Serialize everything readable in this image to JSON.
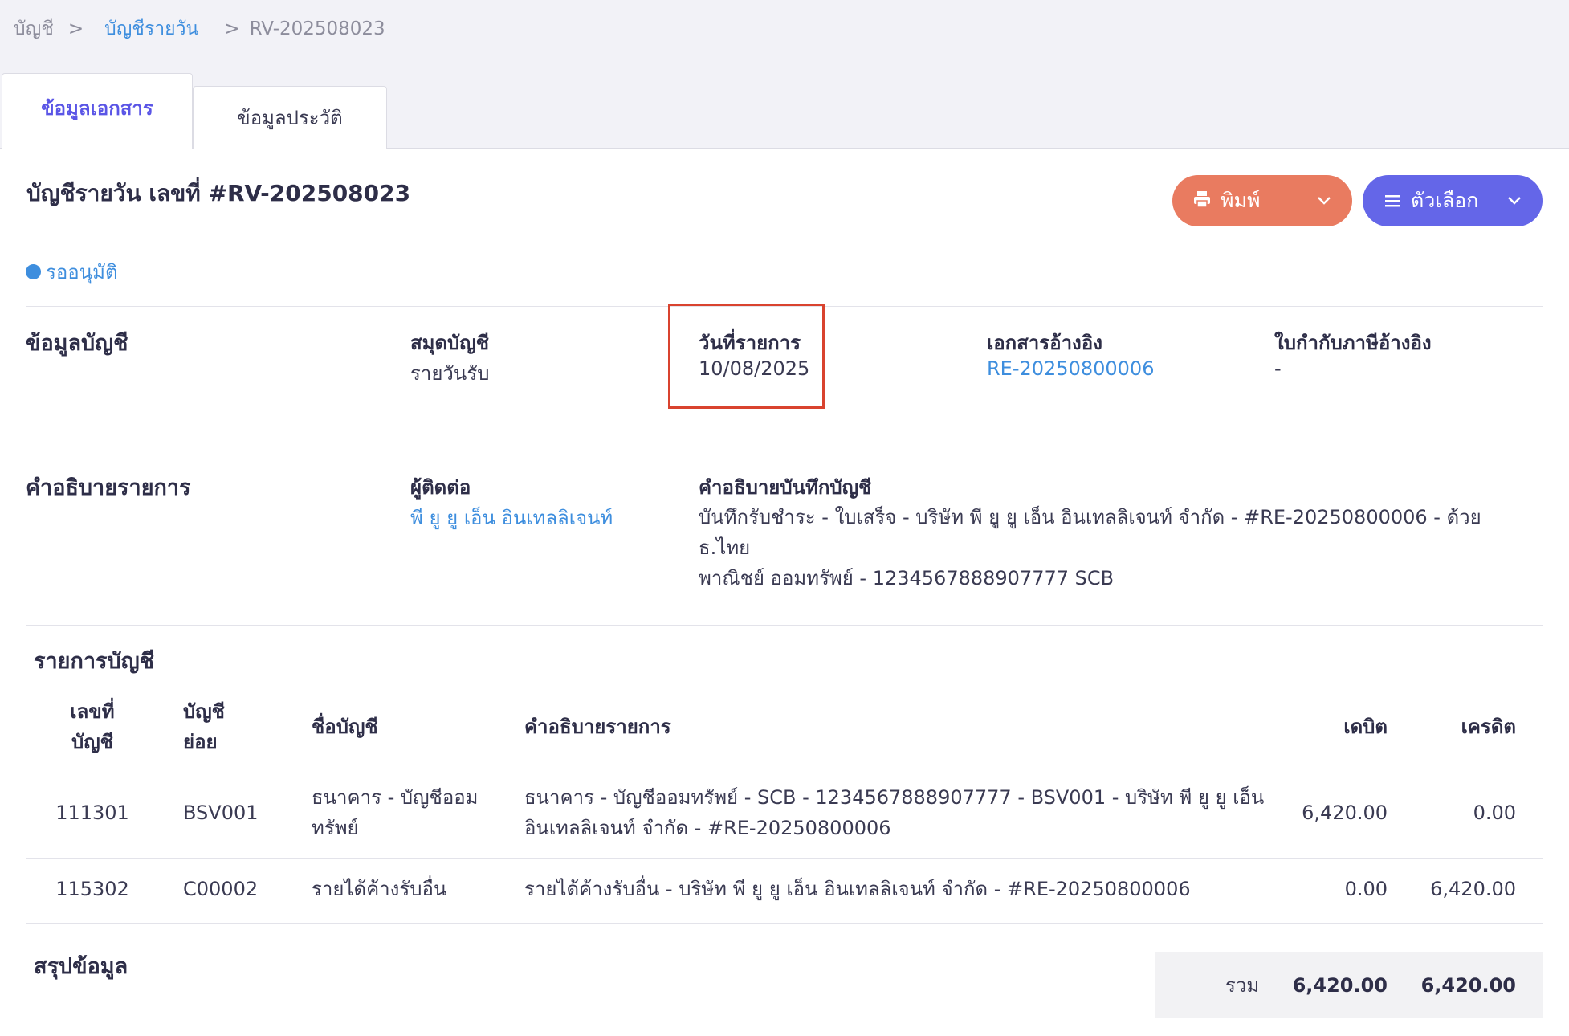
{
  "breadcrumb": {
    "root": "บัญชี",
    "parent": "บัญชีรายวัน",
    "current": "RV-202508023",
    "separator": ">"
  },
  "tabs": [
    {
      "label": "ข้อมูลเอกสาร"
    },
    {
      "label": "ข้อมูลประวัติ"
    }
  ],
  "header": {
    "title": "บัญชีรายวัน เลขที่ #RV-202508023",
    "status": "รออนุมัติ",
    "print_label": "พิมพ์",
    "options_label": "ตัวเลือก"
  },
  "account_info": {
    "section_title": "ข้อมูลบัญชี",
    "journal_label": "สมุดบัญชี",
    "journal_value": "รายวันรับ",
    "date_label": "วันที่รายการ",
    "date_value": "10/08/2025",
    "ref_doc_label": "เอกสารอ้างอิง",
    "ref_doc_value": "RE-20250800006",
    "tax_invoice_label": "ใบกำกับภาษีอ้างอิง",
    "tax_invoice_value": "-"
  },
  "description": {
    "section_title": "คำอธิบายรายการ",
    "contact_label": "ผู้ติดต่อ",
    "contact_value": "พี ยู ยู เอ็น อินเทลลิเจนท์",
    "note_label": "คำอธิบายบันทึกบัญชี",
    "note_line1": "บันทึกรับชำระ - ใบเสร็จ - บริษัท พี ยู ยู เอ็น อินเทลลิเจนท์ จำกัด - #RE-20250800006 - ด้วย ธ.ไทย",
    "note_line2": "พาณิชย์ ออมทรัพย์ - 1234567888907777 SCB"
  },
  "entries": {
    "section_title": "รายการบัญชี",
    "columns": {
      "account_no_1": "เลขที่",
      "account_no_2": "บัญชี",
      "sub_account_1": "บัญชี",
      "sub_account_2": "ย่อย",
      "account_name": "ชื่อบัญชี",
      "description": "คำอธิบายรายการ",
      "debit": "เดบิต",
      "credit": "เครดิต"
    },
    "rows": [
      {
        "account_no": "111301",
        "sub_account": "BSV001",
        "name_1": "ธนาคาร - บัญชีออม",
        "name_2": "ทรัพย์",
        "desc_1": "ธนาคาร - บัญชีออมทรัพย์ - SCB - 1234567888907777 - BSV001 - บริษัท พี ยู ยู เอ็น",
        "desc_2": "อินเทลลิเจนท์ จำกัด - #RE-20250800006",
        "debit": "6,420.00",
        "credit": "0.00"
      },
      {
        "account_no": "115302",
        "sub_account": "C00002",
        "name_1": "รายได้ค้างรับอื่น",
        "desc_1": "รายได้ค้างรับอื่น - บริษัท พี ยู ยู เอ็น อินเทลลิเจนท์ จำกัด - #RE-20250800006",
        "debit": "0.00",
        "credit": "6,420.00"
      }
    ]
  },
  "summary": {
    "section_title": "สรุปข้อมูล",
    "total_label": "รวม",
    "total_debit": "6,420.00",
    "total_credit": "6,420.00"
  },
  "colors": {
    "accent": "#5a55e6",
    "link": "#3e8ede",
    "print_button": "#e97b60",
    "options_button": "#6466e8",
    "highlight": "#d9432f"
  },
  "icons": {
    "print": "printer-icon",
    "options": "menu-icon",
    "dropdown": "chevron-down-icon",
    "status": "status-dot"
  }
}
